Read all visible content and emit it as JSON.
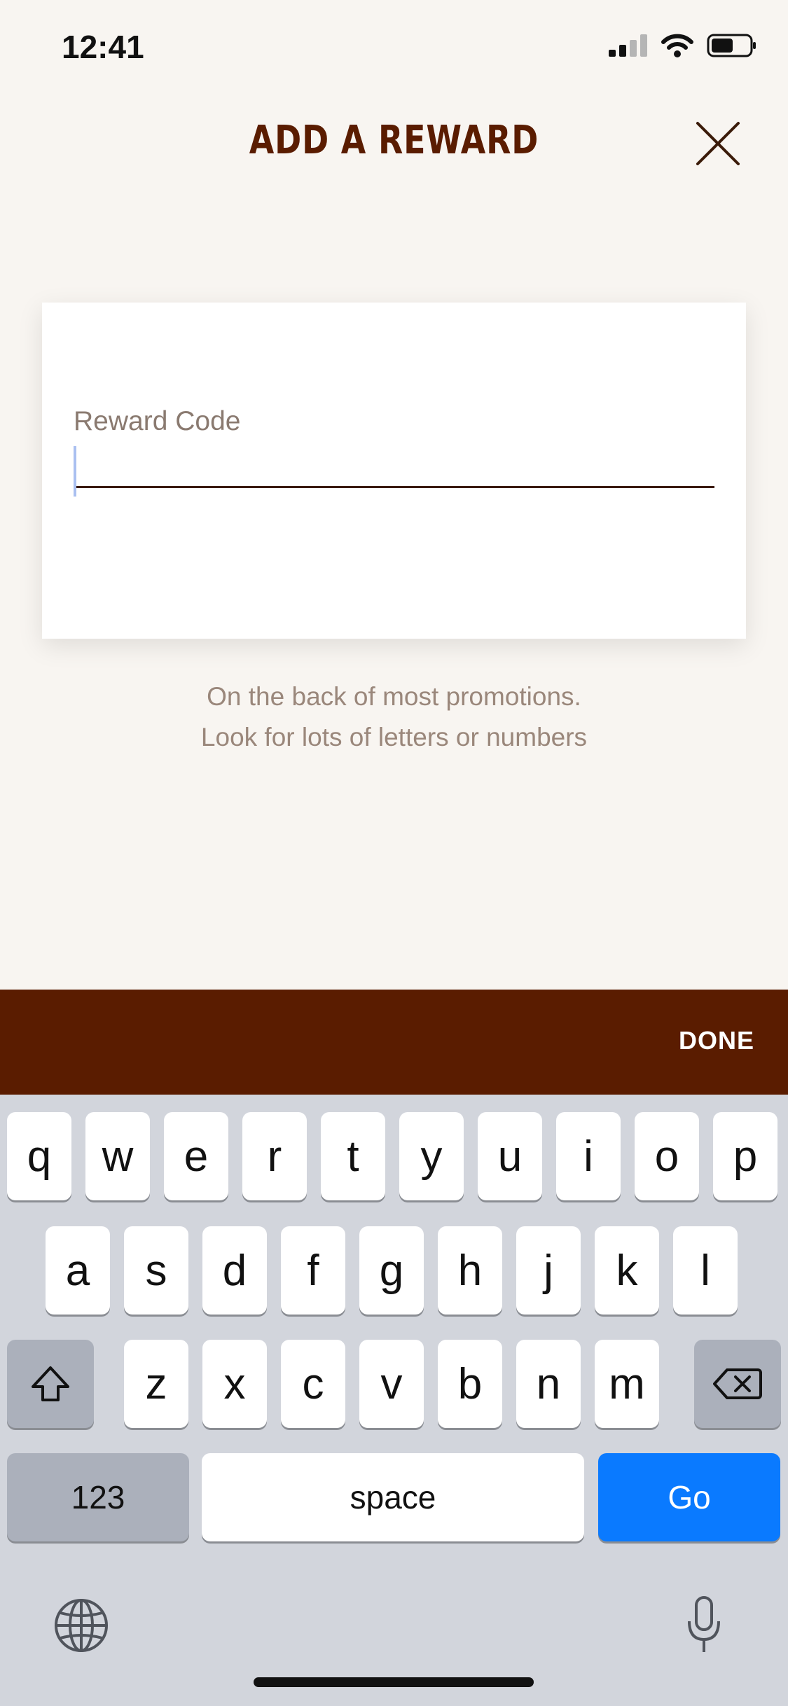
{
  "status": {
    "time": "12:41"
  },
  "header": {
    "title": "ADD A REWARD"
  },
  "form": {
    "label": "Reward Code",
    "value": ""
  },
  "hint": {
    "line1": "On the back of most promotions.",
    "line2": "Look for lots of letters or numbers"
  },
  "toolbar": {
    "done_label": "DONE"
  },
  "keyboard": {
    "row1": [
      "q",
      "w",
      "e",
      "r",
      "t",
      "y",
      "u",
      "i",
      "o",
      "p"
    ],
    "row2": [
      "a",
      "s",
      "d",
      "f",
      "g",
      "h",
      "j",
      "k",
      "l"
    ],
    "row3": [
      "z",
      "x",
      "c",
      "v",
      "b",
      "n",
      "m"
    ],
    "numbers_label": "123",
    "space_label": "space",
    "go_label": "Go"
  },
  "colors": {
    "brand_brown": "#5a1c00",
    "background": "#f8f5f1",
    "go_blue": "#0a7aff"
  }
}
